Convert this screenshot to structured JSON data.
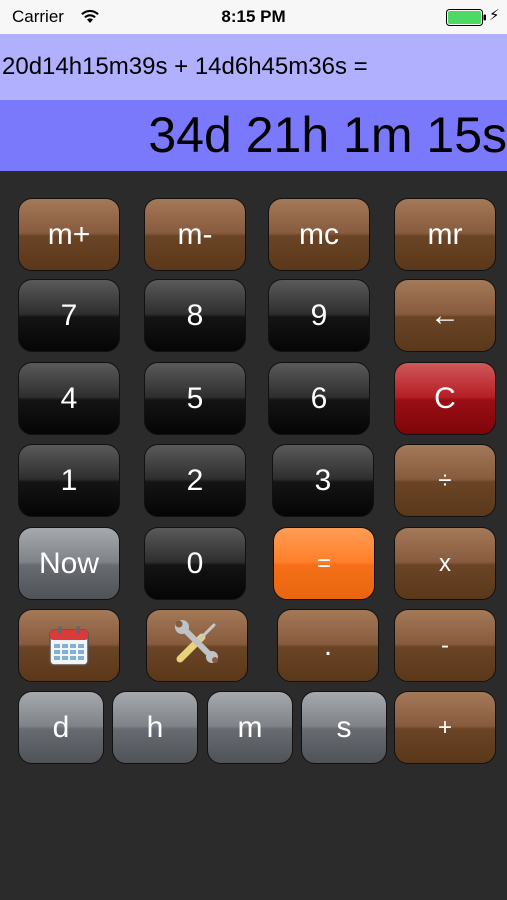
{
  "status_bar": {
    "carrier": "Carrier",
    "time": "8:15 PM"
  },
  "display": {
    "expression": "20d14h15m39s + 14d6h45m36s =",
    "result": "34d 21h 1m 15s"
  },
  "keys": {
    "m_plus": "m+",
    "m_minus": "m-",
    "mc": "mc",
    "mr": "mr",
    "seven": "7",
    "eight": "8",
    "nine": "9",
    "backspace": "←",
    "four": "4",
    "five": "5",
    "six": "6",
    "clear": "C",
    "one": "1",
    "two": "2",
    "three": "3",
    "divide": "÷",
    "now": "Now",
    "zero": "0",
    "equals": "=",
    "multiply": "x",
    "decimal": ".",
    "minus": "-",
    "days": "d",
    "hours": "h",
    "minutes": "m",
    "seconds": "s",
    "plus": "+"
  },
  "icons": {
    "calendar": "calendar-icon",
    "settings": "tools-icon"
  },
  "colors": {
    "expression_bg": "#b1b0ff",
    "result_bg": "#7b79fb",
    "background": "#2b2b2b",
    "brown_key": "#875b3d",
    "black_key": "#1a1a1a",
    "gray_key": "#7f8388",
    "clear_key": "#b41f25",
    "equals_key": "#ff7f2a",
    "battery": "#4cd964"
  }
}
